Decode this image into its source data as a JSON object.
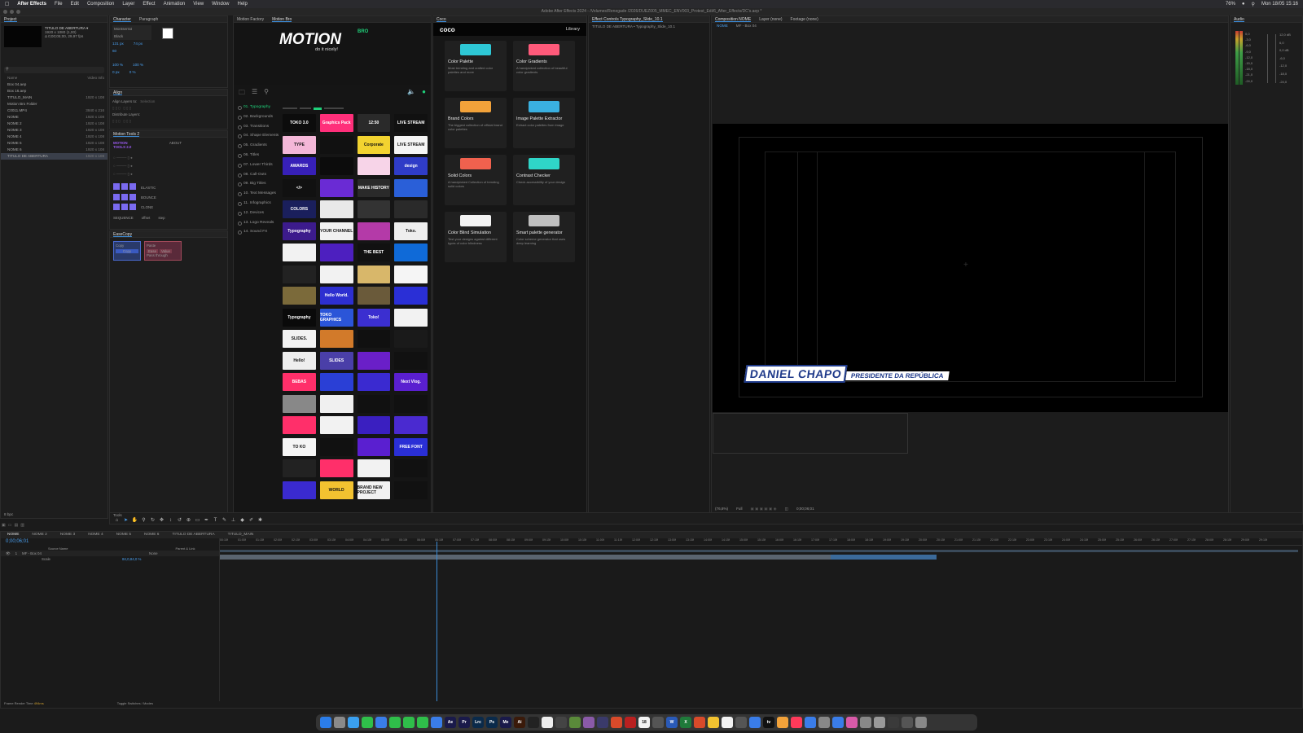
{
  "menubar": {
    "app": "After Effects",
    "items": [
      "File",
      "Edit",
      "Composition",
      "Layer",
      "Effect",
      "Animation",
      "View",
      "Window",
      "Help"
    ],
    "battery": "76%",
    "clock": "Mon 18/05 15:16"
  },
  "titlebar": "Adobe After Effects 2024 - /Volumes/Renegade /2026/DUEZ005_MMEC_ENV003_Protest_Edi/6_After_Effects/DC's.aep *",
  "project": {
    "tab": "Project",
    "selected_name": "TITULO DE ABERTURA ▾",
    "selected_info1": "1920 x 1080 (1,00)",
    "selected_info2": "Δ 0;00;05;00, 29,97 fps",
    "col_name": "Name",
    "col_video": "Video Info",
    "items": [
      {
        "name": "Box 04.aep",
        "size": ""
      },
      {
        "name": "Box 16.aep",
        "size": ""
      },
      {
        "name": "TITULO_MAIN",
        "size": "1920 x 108"
      },
      {
        "name": "Motion Bro Folder",
        "size": ""
      },
      {
        "name": "C0011.MP4",
        "size": "3840 x 216"
      },
      {
        "name": "NOME",
        "size": "1920 x 108"
      },
      {
        "name": "NOME 2",
        "size": "1920 x 108"
      },
      {
        "name": "NOME 3",
        "size": "1920 x 108"
      },
      {
        "name": "NOME 4",
        "size": "1920 x 108"
      },
      {
        "name": "NOME 5",
        "size": "1920 x 108"
      },
      {
        "name": "NOME 6",
        "size": "1920 x 108"
      },
      {
        "name": "TITULO DE ABERTURA",
        "size": "1920 x 108"
      }
    ],
    "footer_bpc": "8 bpc"
  },
  "character": {
    "tab1": "Character",
    "tab2": "Paragraph",
    "font": "Montserrat",
    "style": "Black",
    "size": "131 px",
    "leading": "74 px",
    "tracking": "60",
    "scale_v": "100 %",
    "scale_h": "100 %",
    "baseline": "0 px",
    "tsume": "0 %"
  },
  "align": {
    "tab": "Align",
    "align_to": "Align Layers to:",
    "align_to_value": "Selection",
    "distribute": "Distribute Layers:"
  },
  "motiontools": {
    "tab": "Motion Tools 2",
    "logo": "MOTION TOOLS 2.0",
    "about": "ABOUT",
    "elastic": "ELASTIC",
    "bounce": "BOUNCE",
    "clone": "CLONE",
    "sequence": "SEQUENCE",
    "offset": "offset",
    "step": "step"
  },
  "easecopy": {
    "tab": "EaseCopy",
    "copy": "Copy",
    "paste": "Paste",
    "ease": "Ease",
    "value": "Value",
    "pass_through": "Pass through"
  },
  "motionbro": {
    "tab1": "Motion Factory",
    "tab2": "Motion Bro",
    "logo": "MOTION",
    "logo_sub": "do it nicely!",
    "logo_badge": "BRO",
    "categories": [
      "01. Typography",
      "02. Backgrounds",
      "03. Transitions",
      "04. Shape Elements",
      "05. Gradients",
      "06. Titles",
      "07. Lower Thirds",
      "08. Call-Outs",
      "09. Big Titles",
      "10. Text Messages",
      "11. Infographics",
      "12. Devices",
      "13. Logo Reveals",
      "14. Sound FX"
    ],
    "thumbs": [
      {
        "label": "TOKO 3.0",
        "bg": "#0c0c0c"
      },
      {
        "label": "Graphics Pack",
        "bg": "#ff2f7a"
      },
      {
        "label": "12:50",
        "bg": "#2a2a2a"
      },
      {
        "label": "LIVE STREAM",
        "bg": "#111"
      },
      {
        "label": "TYPE",
        "bg": "#f4b7d8"
      },
      {
        "label": "",
        "bg": "#111"
      },
      {
        "label": "Corporate",
        "bg": "#f2d330"
      },
      {
        "label": "LIVE STREAM",
        "bg": "#f5f5f5"
      },
      {
        "label": "AWARDS",
        "bg": "#3720b8"
      },
      {
        "label": "",
        "bg": "#0c0c0c"
      },
      {
        "label": "",
        "bg": "#f7d4e8"
      },
      {
        "label": "design",
        "bg": "#2f3cc7"
      },
      {
        "label": "</>",
        "bg": "#111"
      },
      {
        "label": "",
        "bg": "#6a2bd4"
      },
      {
        "label": "MAKE HISTORY",
        "bg": "#2a2a2a"
      },
      {
        "label": "",
        "bg": "#2a5fd8"
      },
      {
        "label": "COLORS",
        "bg": "#1a1f5c"
      },
      {
        "label": "",
        "bg": "#e9e9e9"
      },
      {
        "label": "",
        "bg": "#333"
      },
      {
        "label": "",
        "bg": "#2a2a2a"
      },
      {
        "label": "Typography",
        "bg": "#3c1b8c"
      },
      {
        "label": "YOUR CHANNEL",
        "bg": "#f1f1f1"
      },
      {
        "label": "",
        "bg": "#b43aa8"
      },
      {
        "label": "Toko.",
        "bg": "#eee"
      },
      {
        "label": "",
        "bg": "#f2f2f2"
      },
      {
        "label": "",
        "bg": "#4d1fbf"
      },
      {
        "label": "THE BEST",
        "bg": "#111"
      },
      {
        "label": "",
        "bg": "#0f6ad8"
      },
      {
        "label": "",
        "bg": "#222"
      },
      {
        "label": "",
        "bg": "#f2f2f2"
      },
      {
        "label": "",
        "bg": "#d8b76a"
      },
      {
        "label": "",
        "bg": "#f5f5f5"
      },
      {
        "label": "",
        "bg": "#7b6a3a"
      },
      {
        "label": "Hello World.",
        "bg": "#2d2fd0"
      },
      {
        "label": "",
        "bg": "#6a5a3a"
      },
      {
        "label": "",
        "bg": "#2a2fd6"
      },
      {
        "label": "Typography",
        "bg": "#0a0a0a"
      },
      {
        "label": "TOKO GRAPHICS",
        "bg": "#2b55d8"
      },
      {
        "label": "Toko!",
        "bg": "#3b2fd0"
      },
      {
        "label": "",
        "bg": "#f2f2f2"
      },
      {
        "label": "SLIDES.",
        "bg": "#f2f2f2"
      },
      {
        "label": "",
        "bg": "#d27a2a"
      },
      {
        "label": "",
        "bg": "#101010"
      },
      {
        "label": "",
        "bg": "#1a1a1a"
      },
      {
        "label": "Hello!",
        "bg": "#eee"
      },
      {
        "label": "SLIDES",
        "bg": "#4a3fa8"
      },
      {
        "label": "",
        "bg": "#6a1fc8"
      },
      {
        "label": "",
        "bg": "#111"
      },
      {
        "label": "BEBAS",
        "bg": "#ff2f6a"
      },
      {
        "label": "",
        "bg": "#2a3fd6"
      },
      {
        "label": "",
        "bg": "#3a2ad0"
      },
      {
        "label": "Next Vlog.",
        "bg": "#5a1fd0"
      },
      {
        "label": "",
        "bg": "#888"
      },
      {
        "label": "",
        "bg": "#f0f0f0"
      },
      {
        "label": "",
        "bg": "#111"
      },
      {
        "label": "",
        "bg": "#111"
      },
      {
        "label": "",
        "bg": "#ff2f6a"
      },
      {
        "label": "",
        "bg": "#f2f2f2"
      },
      {
        "label": "",
        "bg": "#3a1fc0"
      },
      {
        "label": "",
        "bg": "#4a2ad0"
      },
      {
        "label": "TO KO",
        "bg": "#f5f5f5"
      },
      {
        "label": "",
        "bg": "#111"
      },
      {
        "label": "",
        "bg": "#5a1fd0"
      },
      {
        "label": "FREE FONT",
        "bg": "#2a2fd6"
      },
      {
        "label": "",
        "bg": "#222"
      },
      {
        "label": "",
        "bg": "#ff2f6a"
      },
      {
        "label": "",
        "bg": "#f2f2f2"
      },
      {
        "label": "",
        "bg": "#111"
      },
      {
        "label": "",
        "bg": "#3a2ad0"
      },
      {
        "label": "WORLD",
        "bg": "#f2c230"
      },
      {
        "label": "BRAND NEW PROJECT",
        "bg": "#f2f2f2"
      },
      {
        "label": "",
        "bg": "#111"
      }
    ]
  },
  "coco": {
    "tab": "Coco",
    "brand": "coco",
    "library": "Library",
    "cards": [
      {
        "title": "Color Palette",
        "desc": "Most trending and crafted color palettes and more",
        "icon_color": "#2ec8d6"
      },
      {
        "title": "Color Gradients",
        "desc": "A handpicked collection of beautiful color gradients",
        "icon_color": "#ff5a7a"
      },
      {
        "title": "Brand Colors",
        "desc": "The biggest collection of official brand color palettes",
        "icon_color": "#f2a23a"
      },
      {
        "title": "Image Palette Extractor",
        "desc": "Extract color palettes from image",
        "icon_color": "#3ab0e0"
      },
      {
        "title": "Solid Colors",
        "desc": "A handpicked Collection of trending solid colors",
        "icon_color": "#f0614e"
      },
      {
        "title": "Contrast Checker",
        "desc": "Check accessibility of your design",
        "icon_color": "#2fd6c8"
      },
      {
        "title": "Color Blind Simulation",
        "desc": "Test your designs against different types of color blindness",
        "icon_color": "#f2f2f2"
      },
      {
        "title": "Smart palette generator",
        "desc": "Color scheme generator that uses deep learning",
        "icon_color": "#bfbfbf"
      }
    ]
  },
  "effects": {
    "tab": "Effect Controls Typography_Slide_10.1",
    "layer": "TITULO DE ABERTURA • Typography_Slide_10.1"
  },
  "composition": {
    "tab": "Composition NOME",
    "layer_tab": "Layer (none)",
    "footage_tab": "Footage (none)",
    "crumb1": "NOME",
    "crumb2": "MF - Box 04",
    "name_line1": "DANIEL CHAPO",
    "name_line2": "PRESIDENTE DA REPÚBLICA",
    "zoom": "(76,8%)",
    "res": "Full",
    "timecode": "0;00;06;01"
  },
  "audio": {
    "tab": "Audio",
    "levels": [
      "0,0",
      "-3,0",
      "-6,0",
      "-9,0",
      "-12,0",
      "-15,0",
      "-18,0",
      "-21,0",
      "-24,0"
    ],
    "db": [
      "12,0 dB",
      "6,0",
      "0,0 dB",
      "-6,0",
      "-12,0",
      "-18,0",
      "-24,0"
    ]
  },
  "tools": {
    "tab": "Tools"
  },
  "timeline": {
    "tabs": [
      "NOME",
      "NOME 2",
      "NOME 3",
      "NOME 4",
      "NOME 5",
      "NOME 6",
      "TITULO DE ABERTURA",
      "TITULO_MAIN"
    ],
    "current_time": "0;00;06;01",
    "col_source": "Source Name",
    "col_parent": "Parent & Link",
    "layer_num": "1",
    "layer_name": "MF - Box 04",
    "parent": "None",
    "prop": "Scale",
    "prop_value": "84,0,84,0 %",
    "ruler": [
      "00:15f",
      "01:00f",
      "01:15f",
      "02:00f",
      "02:15f",
      "03:00f",
      "03:15f",
      "04:00f",
      "04:15f",
      "05:00f",
      "05:15f",
      "06:00f",
      "06:15f",
      "07:00f",
      "07:15f",
      "08:00f",
      "08:15f",
      "09:00f",
      "09:15f",
      "10:00f",
      "10:15f",
      "11:00f",
      "11:15f",
      "12:00f",
      "12:15f",
      "13:00f",
      "13:15f",
      "14:00f",
      "14:15f",
      "15:00f",
      "15:15f",
      "16:00f",
      "16:15f",
      "17:00f",
      "17:15f",
      "18:00f",
      "18:15f",
      "19:00f",
      "19:15f",
      "20:00f",
      "20:15f",
      "21:00f",
      "21:15f",
      "22:00f",
      "22:15f",
      "23:00f",
      "23:15f",
      "24:00f",
      "24:15f",
      "25:00f",
      "25:15f",
      "26:00f",
      "26:15f",
      "27:00f",
      "27:15f",
      "28:00f",
      "28:15f",
      "29:00f",
      "29:15f"
    ],
    "render_time_label": "Frame Render Time",
    "render_time": "494ms",
    "toggle": "Toggle Switches / Modes"
  },
  "dock": [
    {
      "label": "",
      "color": "#2b7de9"
    },
    {
      "label": "",
      "color": "#8a8a8a"
    },
    {
      "label": "",
      "color": "#3aa0f0"
    },
    {
      "label": "",
      "color": "#2fbf4a"
    },
    {
      "label": "",
      "color": "#3a7de9"
    },
    {
      "label": "",
      "color": "#2fbf4a"
    },
    {
      "label": "",
      "color": "#2fbf4a"
    },
    {
      "label": "",
      "color": "#2fbf4a"
    },
    {
      "label": "",
      "color": "#3a7de9"
    },
    {
      "label": "Ae",
      "color": "#1a1a4a"
    },
    {
      "label": "Pr",
      "color": "#1a1a4a"
    },
    {
      "label": "Lrc",
      "color": "#0a2a4a"
    },
    {
      "label": "Ps",
      "color": "#0a2a4a"
    },
    {
      "label": "Me",
      "color": "#1a1a4a"
    },
    {
      "label": "Ai",
      "color": "#3a1a0a"
    },
    {
      "label": "",
      "color": "#222"
    },
    {
      "label": "",
      "color": "#eee"
    },
    {
      "label": "",
      "color": "#444"
    },
    {
      "label": "",
      "color": "#5a8a3a"
    },
    {
      "label": "",
      "color": "#8a5aa8"
    },
    {
      "label": "",
      "color": "#3a3a6a"
    },
    {
      "label": "",
      "color": "#d84a2a"
    },
    {
      "label": "",
      "color": "#b82020"
    },
    {
      "label": "18",
      "color": "#f2f2f2"
    },
    {
      "label": "",
      "color": "#555"
    },
    {
      "label": "W",
      "color": "#2a5ab8"
    },
    {
      "label": "X",
      "color": "#1f7a3a"
    },
    {
      "label": "",
      "color": "#d84a2a"
    },
    {
      "label": "",
      "color": "#f2c230"
    },
    {
      "label": "",
      "color": "#f2f2f2"
    },
    {
      "label": "",
      "color": "#555"
    },
    {
      "label": "",
      "color": "#3a7de9"
    },
    {
      "label": "tv",
      "color": "#111"
    },
    {
      "label": "",
      "color": "#f2a23a"
    },
    {
      "label": "",
      "color": "#ff3a5a"
    },
    {
      "label": "",
      "color": "#3a7de9"
    },
    {
      "label": "",
      "color": "#888"
    },
    {
      "label": "",
      "color": "#3a7de9"
    },
    {
      "label": "",
      "color": "#d85aa8"
    },
    {
      "label": "",
      "color": "#888"
    },
    {
      "label": "",
      "color": "#999"
    },
    {
      "label": "",
      "color": "#3a3a3a"
    },
    {
      "label": "",
      "color": "#555"
    },
    {
      "label": "",
      "color": "#888"
    }
  ]
}
